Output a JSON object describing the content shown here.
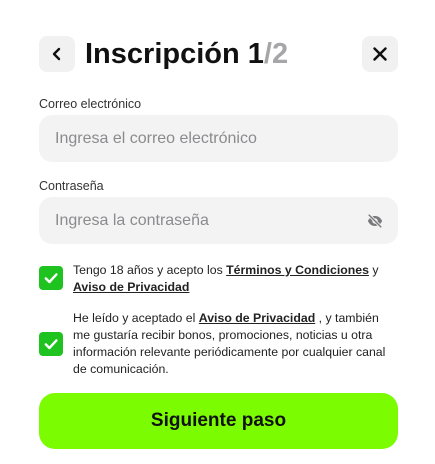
{
  "header": {
    "title": "Inscripción 1",
    "step_total": "/2",
    "back_icon": "chevron-left-icon",
    "close_icon": "close-icon"
  },
  "form": {
    "email": {
      "label": "Correo electrónico",
      "placeholder": "Ingresa el correo electrónico",
      "value": ""
    },
    "password": {
      "label": "Contraseña",
      "placeholder": "Ingresa la contraseña",
      "value": "",
      "toggle_icon": "eye-off-icon"
    }
  },
  "consents": {
    "terms": {
      "checked": true,
      "text_before": "Tengo 18 años y acepto los ",
      "link1": "Términos y Condiciones",
      "text_middle": " y",
      "link2": "Aviso de Privacidad"
    },
    "marketing": {
      "checked": true,
      "text_before": "He leído y aceptado el ",
      "link": "Aviso de Privacidad",
      "text_after": " , y también me gustaría recibir bonos, promociones, noticias u otra información relevante periódicamente por cualquier canal de comunicación."
    }
  },
  "cta": {
    "label": "Siguiente paso"
  },
  "colors": {
    "accent": "#7cfc00",
    "checkbox": "#1fc31f",
    "input_bg": "#f3f3f4",
    "step_muted": "#a6a6a8"
  }
}
